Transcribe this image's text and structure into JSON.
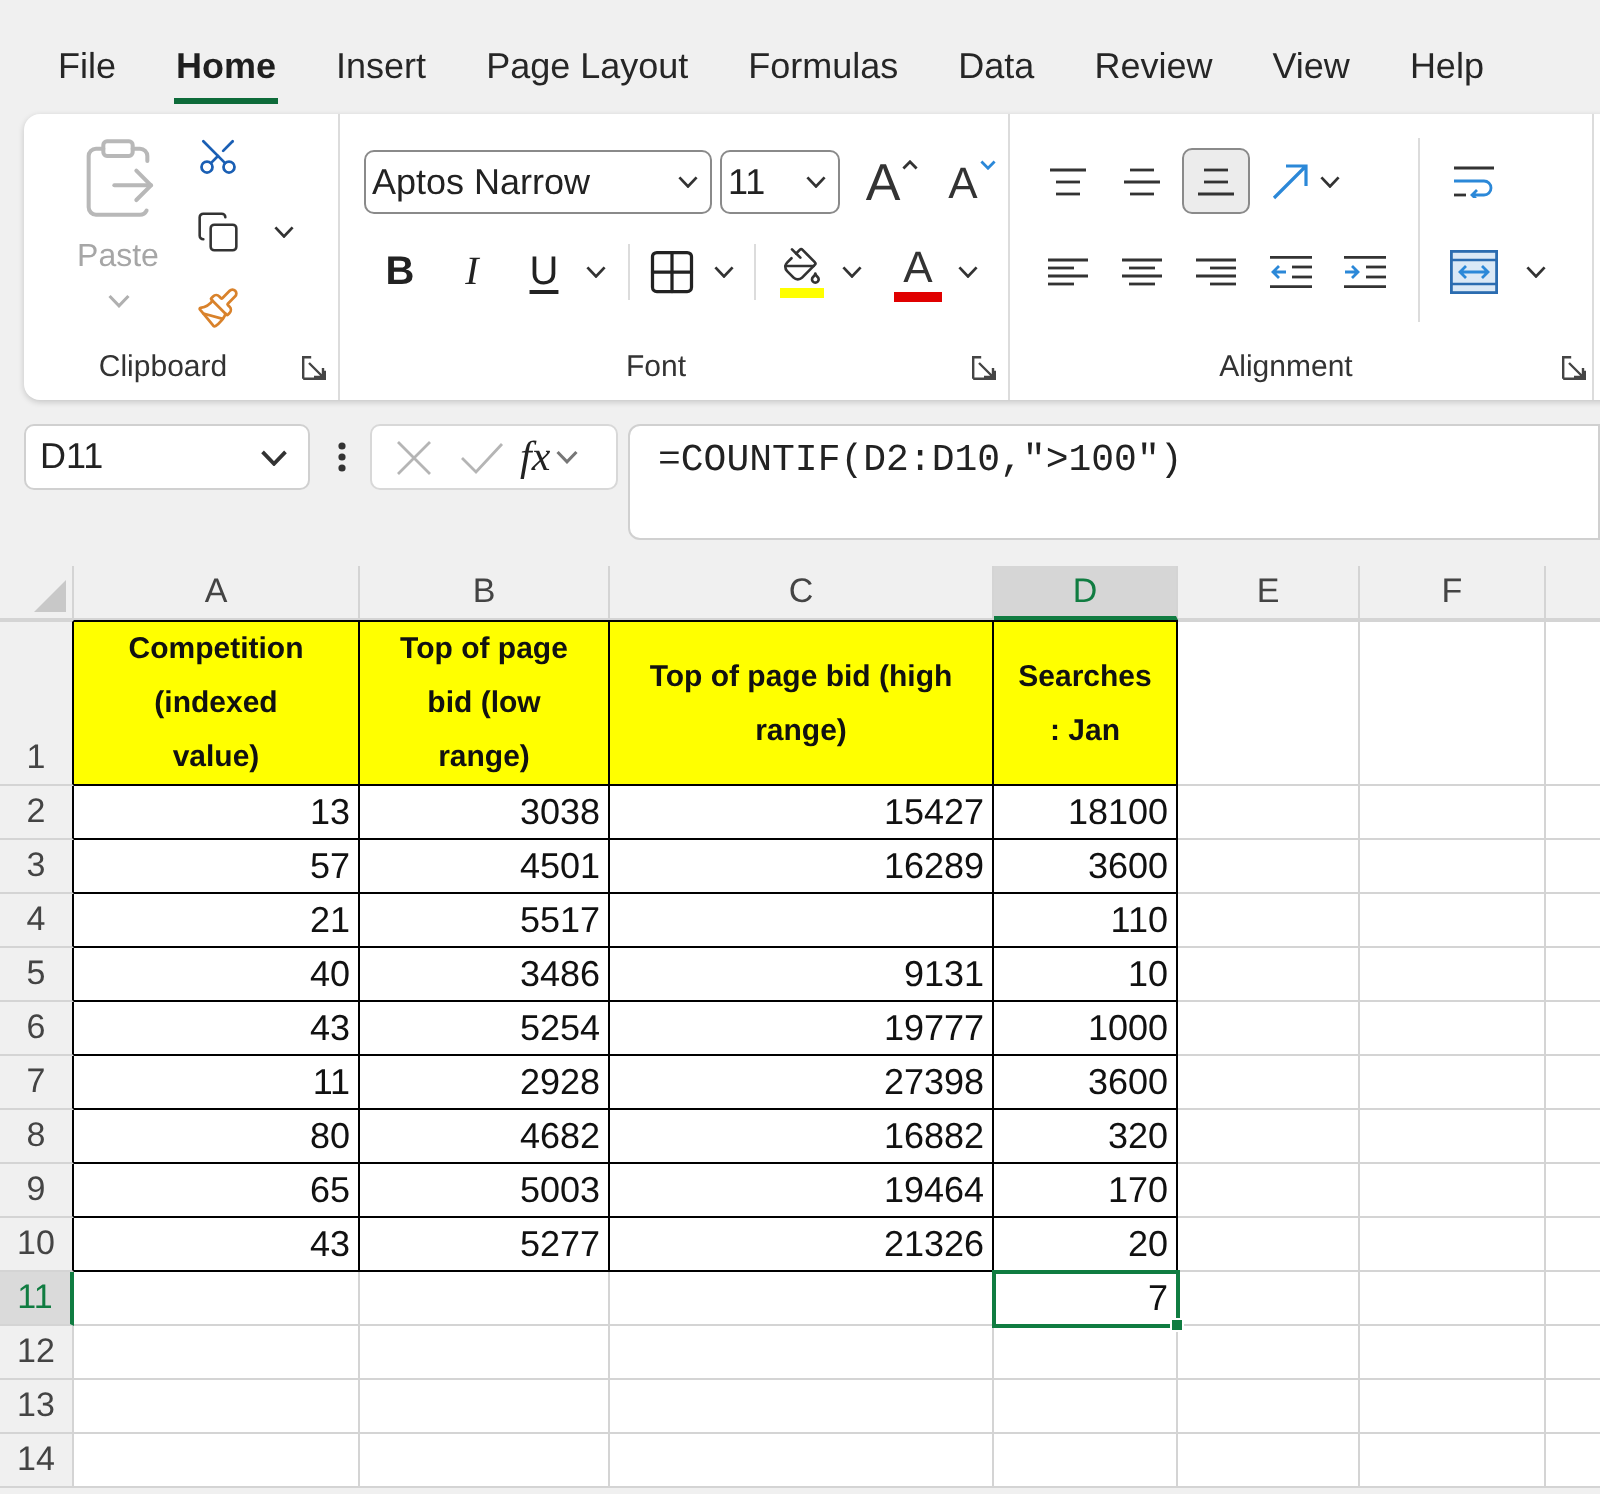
{
  "menu_tabs": [
    {
      "label": "File",
      "selected": false
    },
    {
      "label": "Home",
      "selected": true
    },
    {
      "label": "Insert",
      "selected": false
    },
    {
      "label": "Page Layout",
      "selected": false
    },
    {
      "label": "Formulas",
      "selected": false
    },
    {
      "label": "Data",
      "selected": false
    },
    {
      "label": "Review",
      "selected": false
    },
    {
      "label": "View",
      "selected": false
    },
    {
      "label": "Help",
      "selected": false
    }
  ],
  "clipboard": {
    "label": "Clipboard",
    "paste": {
      "label": "Paste",
      "disabled": true
    }
  },
  "font": {
    "label": "Font",
    "font_name": "Aptos Narrow",
    "font_size": "11",
    "grow_label": "A",
    "shrink_label": "A",
    "style_buttons": [
      {
        "label": "B",
        "kind": "bold"
      },
      {
        "label": "I",
        "kind": "italic"
      },
      {
        "label": "U",
        "kind": "underline"
      }
    ],
    "fill_color": {
      "color": "#ffff00"
    },
    "font_color": {
      "label": "A",
      "color": "#e00000"
    }
  },
  "alignment": {
    "label": "Alignment",
    "vertical": [
      {
        "kind": "top",
        "selected": false
      },
      {
        "kind": "middle",
        "selected": false
      },
      {
        "kind": "bottom",
        "selected": true
      }
    ]
  },
  "formula_bar": {
    "name_box": "D11",
    "function_label": "fx",
    "formula": "=COUNTIF(D2:D10,\">100\")"
  },
  "sheet": {
    "columns": [
      {
        "label": "A",
        "selected": false
      },
      {
        "label": "B",
        "selected": false
      },
      {
        "label": "C",
        "selected": false
      },
      {
        "label": "D",
        "selected": true
      },
      {
        "label": "E",
        "selected": false
      },
      {
        "label": "F",
        "selected": false
      }
    ],
    "rows": [
      {
        "label": "1",
        "kind": "header",
        "selected": false,
        "cells": [
          {
            "value": "Competition (indexed value)",
            "selected": false
          },
          {
            "value": "Top of page bid (low range)",
            "selected": false
          },
          {
            "value": "Top of page bid (high range)",
            "selected": false
          },
          {
            "value": "Searches : Jan",
            "selected": false
          }
        ]
      },
      {
        "label": "2",
        "kind": "data",
        "selected": false,
        "cells": [
          {
            "value": "13",
            "selected": false
          },
          {
            "value": "3038",
            "selected": false
          },
          {
            "value": "15427",
            "selected": false
          },
          {
            "value": "18100",
            "selected": false
          }
        ]
      },
      {
        "label": "3",
        "kind": "data",
        "selected": false,
        "cells": [
          {
            "value": "57",
            "selected": false
          },
          {
            "value": "4501",
            "selected": false
          },
          {
            "value": "16289",
            "selected": false
          },
          {
            "value": "3600",
            "selected": false
          }
        ]
      },
      {
        "label": "4",
        "kind": "data",
        "selected": false,
        "cells": [
          {
            "value": "21",
            "selected": false
          },
          {
            "value": "5517",
            "selected": false
          },
          {
            "selected": false
          },
          {
            "value": "110",
            "selected": false
          }
        ]
      },
      {
        "label": "5",
        "kind": "data",
        "selected": false,
        "cells": [
          {
            "value": "40",
            "selected": false
          },
          {
            "value": "3486",
            "selected": false
          },
          {
            "value": "9131",
            "selected": false
          },
          {
            "value": "10",
            "selected": false
          }
        ]
      },
      {
        "label": "6",
        "kind": "data",
        "selected": false,
        "cells": [
          {
            "value": "43",
            "selected": false
          },
          {
            "value": "5254",
            "selected": false
          },
          {
            "value": "19777",
            "selected": false
          },
          {
            "value": "1000",
            "selected": false
          }
        ]
      },
      {
        "label": "7",
        "kind": "data",
        "selected": false,
        "cells": [
          {
            "value": "11",
            "selected": false
          },
          {
            "value": "2928",
            "selected": false
          },
          {
            "value": "27398",
            "selected": false
          },
          {
            "value": "3600",
            "selected": false
          }
        ]
      },
      {
        "label": "8",
        "kind": "data",
        "selected": false,
        "cells": [
          {
            "value": "80",
            "selected": false
          },
          {
            "value": "4682",
            "selected": false
          },
          {
            "value": "16882",
            "selected": false
          },
          {
            "value": "320",
            "selected": false
          }
        ]
      },
      {
        "label": "9",
        "kind": "data",
        "selected": false,
        "cells": [
          {
            "value": "65",
            "selected": false
          },
          {
            "value": "5003",
            "selected": false
          },
          {
            "value": "19464",
            "selected": false
          },
          {
            "value": "170",
            "selected": false
          }
        ]
      },
      {
        "label": "10",
        "kind": "data",
        "selected": false,
        "cells": [
          {
            "value": "43",
            "selected": false
          },
          {
            "value": "5277",
            "selected": false
          },
          {
            "value": "21326",
            "selected": false
          },
          {
            "value": "20",
            "selected": false
          }
        ]
      },
      {
        "label": "11",
        "kind": "plain",
        "selected": true,
        "cells": [
          {
            "selected": false
          },
          {
            "selected": false
          },
          {
            "selected": false
          },
          {
            "value": "7",
            "selected": true
          }
        ]
      },
      {
        "label": "12",
        "kind": "plain",
        "selected": false
      },
      {
        "label": "13",
        "kind": "plain",
        "selected": false
      },
      {
        "label": "14",
        "kind": "plain",
        "selected": false
      }
    ]
  }
}
